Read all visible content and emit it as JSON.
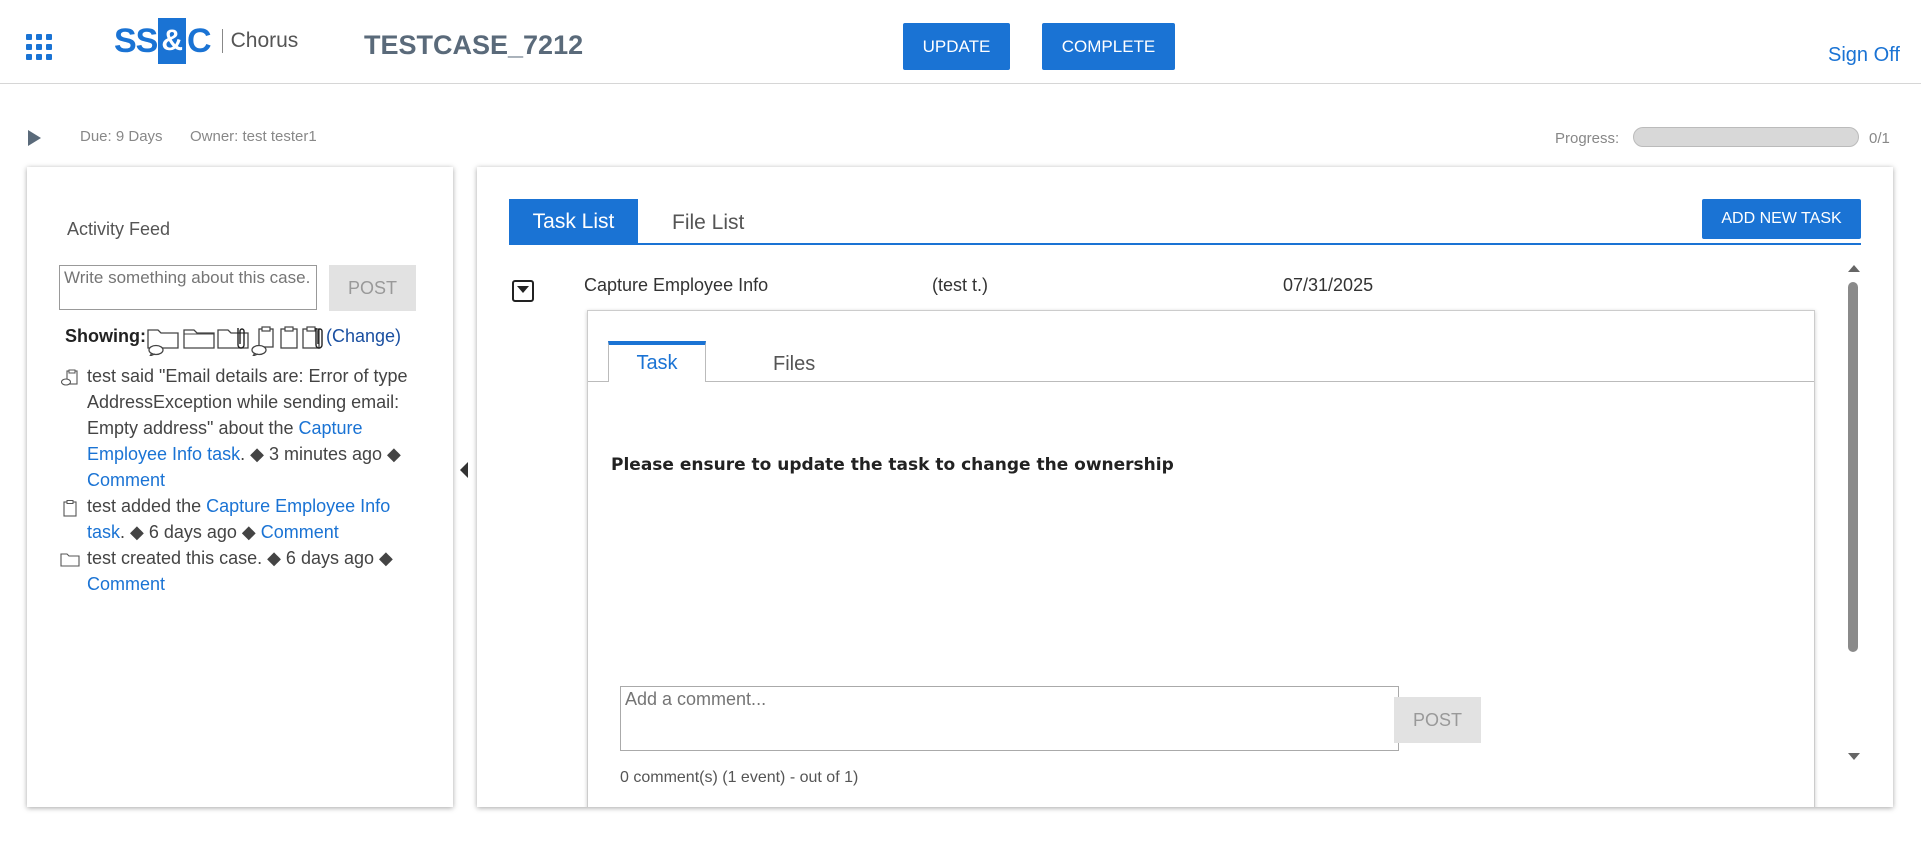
{
  "header": {
    "logo_left": "SS",
    "logo_amp": "&",
    "logo_right": "C",
    "logo_product": "Chorus",
    "case_title": "TESTCASE_7212",
    "update_label": "UPDATE",
    "complete_label": "COMPLETE",
    "sign_off_label": "Sign Off"
  },
  "subheader": {
    "due": "Due: 9 Days",
    "owner": "Owner: test tester1",
    "progress_label": "Progress:",
    "progress_count": "0/1",
    "progress_fraction": 0
  },
  "activity_feed": {
    "title": "Activity Feed",
    "input_placeholder": "Write something about this case.",
    "post_label": "POST",
    "showing_label": "Showing:",
    "change_label": "(Change)",
    "filter_icons": [
      "folder-comment-icon",
      "folder-icon",
      "folder-attachment-icon",
      "clipboard-comment-icon",
      "clipboard-icon",
      "clipboard-attachment-icon"
    ],
    "items": [
      {
        "icon": "comment-clipboard-icon",
        "text": "test said \"Email details are: Error of type AddressException while sending email: Empty address\" about the ",
        "link": "Capture Employee Info task",
        "after": ". ◆ 3 minutes ago ◆ ",
        "comment": "Comment"
      },
      {
        "icon": "clipboard-icon",
        "text": "test added the ",
        "link": "Capture Employee Info task",
        "after": ". ◆ 6 days ago ◆ ",
        "comment": "Comment"
      },
      {
        "icon": "folder-icon",
        "text": "test created this case. ◆ 6 days ago ◆ ",
        "link": "",
        "after": "",
        "comment": "Comment"
      }
    ]
  },
  "main": {
    "tab_task_list": "Task List",
    "tab_file_list": "File List",
    "add_task_label": "ADD NEW TASK",
    "task": {
      "name": "Capture Employee Info",
      "owner": "(test t.)",
      "date": "07/31/2025"
    },
    "detail": {
      "tab_task": "Task",
      "tab_files": "Files",
      "message": "Please ensure to update the task to change the ownership",
      "comment_placeholder": "Add a comment...",
      "post_label": "POST",
      "comment_count": "0 comment(s) (1 event) - out of 1)"
    }
  },
  "colors": {
    "accent": "#1a73d4",
    "button_disabled_bg": "#e2e2e2"
  }
}
